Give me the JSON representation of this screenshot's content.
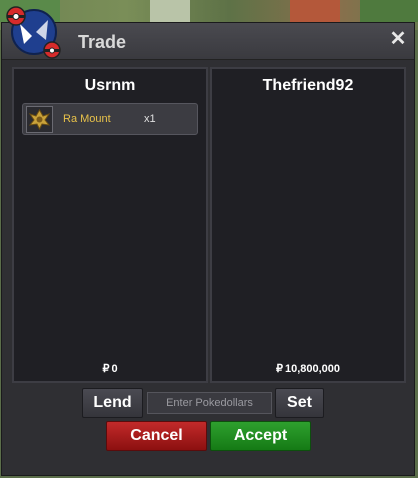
{
  "window": {
    "title": "Trade",
    "close_symbol": "✕"
  },
  "left_panel": {
    "username": "Usrnm",
    "items": [
      {
        "name": "Ra Mount",
        "qty": "x1",
        "icon": "ra-mount-badge-icon"
      }
    ],
    "money_symbol": "₽",
    "money": "0"
  },
  "right_panel": {
    "username": "Thefriend92",
    "items": [],
    "money_symbol": "₽",
    "money": "10,800,000"
  },
  "controls": {
    "lend_label": "Lend",
    "pokedollar_placeholder": "Enter Pokedollars",
    "set_label": "Set",
    "cancel_label": "Cancel",
    "accept_label": "Accept"
  },
  "colors": {
    "cancel": "#c22a2a",
    "accept": "#2ea02e",
    "item_name": "#e8c24a",
    "window_bg": "#2f2f33"
  }
}
